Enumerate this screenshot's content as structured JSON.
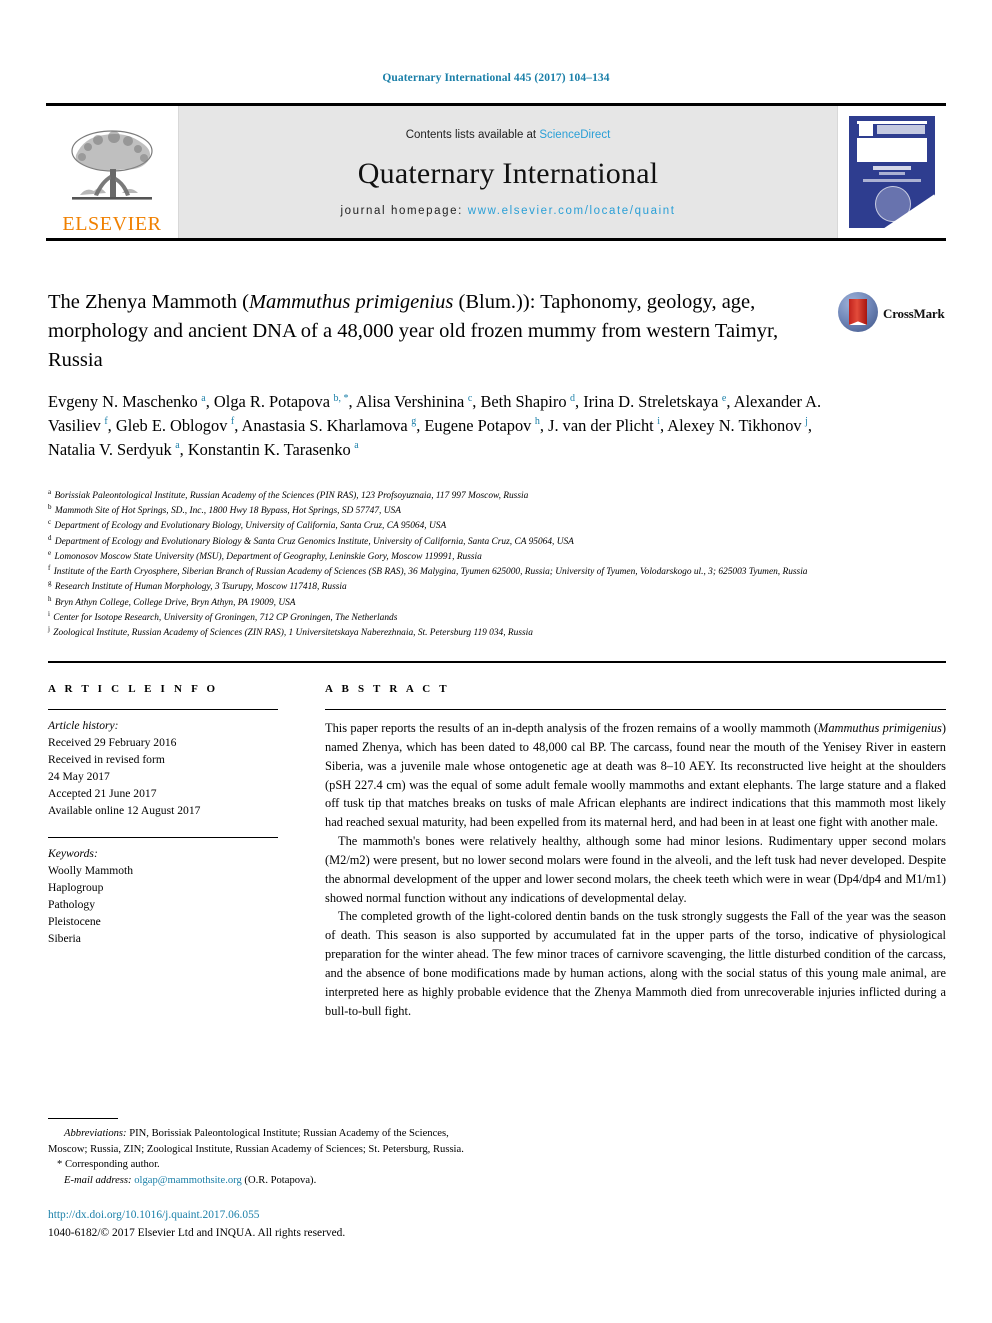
{
  "running_head": "Quaternary International 445 (2017) 104–134",
  "masthead": {
    "contents_prefix": "Contents lists available at ",
    "sciencedirect": "ScienceDirect",
    "journal_title": "Quaternary International",
    "homepage_prefix": "journal homepage: ",
    "homepage_url": "www.elsevier.com/locate/quaint",
    "publisher_wordmark": "ELSEVIER",
    "publisher_logo_icon": "elsevier-tree-icon",
    "cover_thumbnail_icon": "journal-cover-thumbnail"
  },
  "article": {
    "title_line1_a": "The Zhenya Mammoth (",
    "title_line1_italic": "Mammuthus primigenius",
    "title_line1_b": " (Blum.)):",
    "title_line2": "Taphonomy, geology, age, morphology and ancient DNA of a 48,000",
    "title_line3": "year old frozen mummy from western Taimyr, Russia",
    "crossmark_label": "CrossMark",
    "crossmark_icon": "crossmark-icon"
  },
  "authors": [
    {
      "name": "Evgeny N. Maschenko",
      "marks": "a",
      "sep": ", "
    },
    {
      "name": "Olga R. Potapova",
      "marks": "b, *",
      "sep": ", "
    },
    {
      "name": "Alisa Vershinina",
      "marks": "c",
      "sep": ", "
    },
    {
      "name": "Beth Shapiro",
      "marks": "d",
      "sep": ", "
    },
    {
      "name": "Irina D. Streletskaya",
      "marks": "e",
      "sep": ", "
    },
    {
      "name": "Alexander A. Vasiliev",
      "marks": "f",
      "sep": ", "
    },
    {
      "name": "Gleb E. Oblogov",
      "marks": "f",
      "sep": ", "
    },
    {
      "name": "Anastasia S. Kharlamova",
      "marks": "g",
      "sep": ", "
    },
    {
      "name": "Eugene Potapov",
      "marks": "h",
      "sep": ", "
    },
    {
      "name": "J. van der Plicht",
      "marks": "i",
      "sep": ", "
    },
    {
      "name": "Alexey N. Tikhonov",
      "marks": "j",
      "sep": ", "
    },
    {
      "name": "Natalia V. Serdyuk",
      "marks": "a",
      "sep": ", "
    },
    {
      "name": "Konstantin K. Tarasenko",
      "marks": "a",
      "sep": ""
    }
  ],
  "affiliations": [
    {
      "mark": "a",
      "text": "Borissiak Paleontological Institute, Russian Academy of the Sciences (PIN RAS), 123 Profsoyuznaia, 117 997 Moscow, Russia"
    },
    {
      "mark": "b",
      "text": "Mammoth Site of Hot Springs, SD., Inc., 1800 Hwy 18 Bypass, Hot Springs, SD 57747, USA"
    },
    {
      "mark": "c",
      "text": "Department of Ecology and Evolutionary Biology, University of California, Santa Cruz, CA 95064, USA"
    },
    {
      "mark": "d",
      "text": "Department of Ecology and Evolutionary Biology & Santa Cruz Genomics Institute, University of California, Santa Cruz, CA 95064, USA"
    },
    {
      "mark": "e",
      "text": "Lomonosov Moscow State University (MSU), Department of Geography, Leninskie Gory, Moscow 119991, Russia"
    },
    {
      "mark": "f",
      "text": "Institute of the Earth Cryosphere, Siberian Branch of Russian Academy of Sciences (SB RAS), 36 Malygina, Tyumen 625000, Russia; University of Tyumen, Volodarskogo ul., 3; 625003 Tyumen, Russia"
    },
    {
      "mark": "g",
      "text": "Research Institute of Human Morphology, 3 Tsurupy, Moscow 117418, Russia"
    },
    {
      "mark": "h",
      "text": "Bryn Athyn College, College Drive, Bryn Athyn, PA 19009, USA"
    },
    {
      "mark": "i",
      "text": "Center for Isotope Research, University of Groningen, 712 CP Groningen, The Netherlands"
    },
    {
      "mark": "j",
      "text": "Zoological Institute, Russian Academy of Sciences (ZIN RAS), 1 Universitetskaya Naberezhnaia, St. Petersburg 119 034, Russia"
    }
  ],
  "article_info": {
    "heading": "A R T I C L E   I N F O",
    "history_label": "Article history:",
    "history": [
      "Received 29 February 2016",
      "Received in revised form",
      "24 May 2017",
      "Accepted 21 June 2017",
      "Available online 12 August 2017"
    ],
    "keywords_label": "Keywords:",
    "keywords": [
      "Woolly Mammoth",
      "Haplogroup",
      "Pathology",
      "Pleistocene",
      "Siberia"
    ]
  },
  "abstract": {
    "heading": "A B S T R A C T",
    "paragraphs": [
      {
        "pre": "This paper reports the results of an in-depth analysis of the frozen remains of a woolly mammoth (",
        "italic": "Mammuthus primigenius",
        "post": ") named Zhenya, which has been dated to 48,000 cal BP. The carcass, found near the mouth of the Yenisey River in eastern Siberia, was a juvenile male whose ontogenetic age at death was 8–10 AEY. Its reconstructed live height at the shoulders (pSH 227.4 cm) was the equal of some adult female woolly mammoths and extant elephants. The large stature and a flaked off tusk tip that matches breaks on tusks of male African elephants are indirect indications that this mammoth most likely had reached sexual maturity, had been expelled from its maternal herd, and had been in at least one fight with another male."
      },
      {
        "pre": "The mammoth's bones were relatively healthy, although some had minor lesions. Rudimentary upper second molars (M2/m2) were present, but no lower second molars were found in the alveoli, and the left tusk had never developed. Despite the abnormal development of the upper and lower second molars, the cheek teeth which were in wear (Dp4/dp4 and M1/m1) showed normal function without any indications of developmental delay.",
        "italic": "",
        "post": ""
      },
      {
        "pre": "The completed growth of the light-colored dentin bands on the tusk strongly suggests the Fall of the year was the season of death. This season is also supported by accumulated fat in the upper parts of the torso, indicative of physiological preparation for the winter ahead. The few minor traces of carnivore scavenging, the little disturbed condition of the carcass, and the absence of bone modifications made by human actions, along with the social status of this young male animal, are interpreted here as highly probable evidence that the Zhenya Mammoth died from unrecoverable injuries inflicted during a bull-to-bull fight.",
        "italic": "",
        "post": ""
      }
    ]
  },
  "footnotes": {
    "abbreviations_label": "Abbreviations:",
    "abbreviations_text": " PIN, Borissiak Paleontological Institute; Russian Academy of the Sciences, Moscow; Russia, ZIN; Zoological Institute, Russian Academy of Sciences; St. Petersburg, Russia.",
    "corresponding_marker": "*",
    "corresponding_text": "Corresponding author.",
    "email_label": "E-mail address:",
    "email_address": "olgap@mammothsite.org",
    "email_suffix": " (O.R. Potapova)."
  },
  "footer": {
    "doi": "http://dx.doi.org/10.1016/j.quaint.2017.06.055",
    "copyright": "1040-6182/© 2017 Elsevier Ltd and INQUA. All rights reserved."
  },
  "colors": {
    "link": "#1a7fa8",
    "sciencedirect": "#2a9fd6",
    "elsevier_orange": "#f08000",
    "masthead_band": "#e6e6e6",
    "cover_blue": "#2e3d8f"
  }
}
